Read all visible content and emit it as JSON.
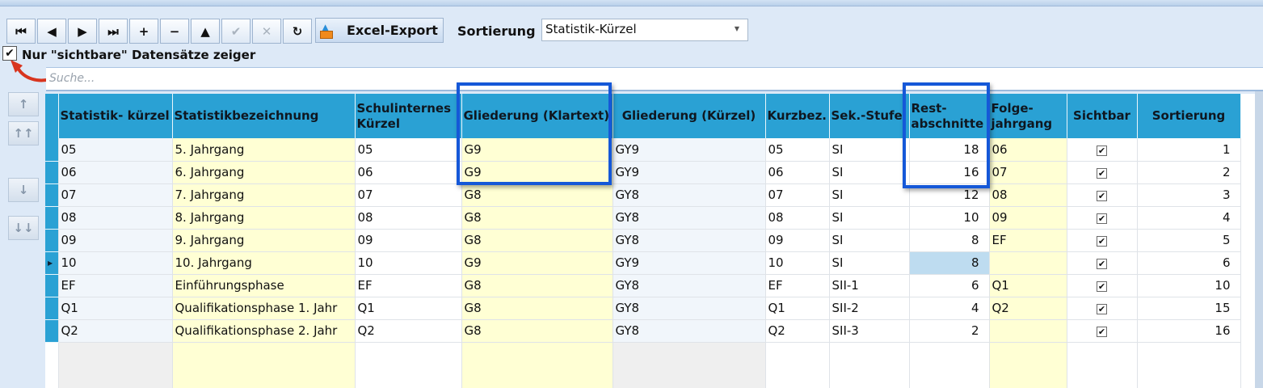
{
  "toolbar": {
    "nav_buttons": [
      {
        "name": "first-record-icon",
        "glyph": "⏮",
        "enabled": true
      },
      {
        "name": "prev-record-icon",
        "glyph": "◀",
        "enabled": true
      },
      {
        "name": "next-record-icon",
        "glyph": "▶",
        "enabled": true
      },
      {
        "name": "last-record-icon",
        "glyph": "⏭",
        "enabled": true
      },
      {
        "name": "add-record-icon",
        "glyph": "+",
        "enabled": true
      },
      {
        "name": "delete-record-icon",
        "glyph": "−",
        "enabled": true
      },
      {
        "name": "edit-record-icon",
        "glyph": "▲",
        "enabled": true
      },
      {
        "name": "confirm-icon",
        "glyph": "✔",
        "enabled": false
      },
      {
        "name": "cancel-icon",
        "glyph": "✕",
        "enabled": false
      },
      {
        "name": "refresh-icon",
        "glyph": "↻",
        "enabled": true
      }
    ],
    "excel_label": "Excel-Export",
    "sort_label": "Sortierung",
    "sort_value": "Statistik-Kürzel"
  },
  "filter": {
    "checked": true,
    "check_glyph": "✔",
    "label": "Nur \"sichtbare\" Datensätze zeiger"
  },
  "search": {
    "placeholder": "Suche..."
  },
  "move_buttons": [
    {
      "name": "move-up-icon",
      "glyph": "↑"
    },
    {
      "name": "move-top-icon",
      "glyph": "↑↑"
    },
    {
      "name": "move-down-icon",
      "glyph": "↓"
    },
    {
      "name": "move-bottom-icon",
      "glyph": "↓↓"
    }
  ],
  "grid": {
    "columns": [
      [
        "Statistik- kürzel"
      ],
      [
        "Statistikbezeichnung"
      ],
      [
        "Schulinternes",
        "Kürzel"
      ],
      [
        "Gliederung (Klartext)"
      ],
      [
        "Gliederung (Kürzel)"
      ],
      [
        "Kurzbez."
      ],
      [
        "Sek.-Stufe"
      ],
      [
        "Rest-",
        "abschnitte"
      ],
      [
        "Folge-",
        "jahrgang"
      ],
      [
        "Sichtbar"
      ],
      [
        "Sortierung"
      ]
    ],
    "rows": [
      {
        "kuerzel": "05",
        "bez": "5. Jahrgang",
        "intern": "05",
        "glk": "G9",
        "gk": "GY9",
        "kurz": "05",
        "stufe": "SI",
        "rest": "18",
        "folge": "06",
        "sichtbar": true,
        "sort": "1"
      },
      {
        "kuerzel": "06",
        "bez": "6. Jahrgang",
        "intern": "06",
        "glk": "G9",
        "gk": "GY9",
        "kurz": "06",
        "stufe": "SI",
        "rest": "16",
        "folge": "07",
        "sichtbar": true,
        "sort": "2"
      },
      {
        "kuerzel": "07",
        "bez": "7. Jahrgang",
        "intern": "07",
        "glk": "G8",
        "gk": "GY8",
        "kurz": "07",
        "stufe": "SI",
        "rest": "12",
        "folge": "08",
        "sichtbar": true,
        "sort": "3"
      },
      {
        "kuerzel": "08",
        "bez": "8. Jahrgang",
        "intern": "08",
        "glk": "G8",
        "gk": "GY8",
        "kurz": "08",
        "stufe": "SI",
        "rest": "10",
        "folge": "09",
        "sichtbar": true,
        "sort": "4"
      },
      {
        "kuerzel": "09",
        "bez": "9. Jahrgang",
        "intern": "09",
        "glk": "G8",
        "gk": "GY8",
        "kurz": "09",
        "stufe": "SI",
        "rest": "8",
        "folge": "EF",
        "sichtbar": true,
        "sort": "5"
      },
      {
        "kuerzel": "10",
        "bez": "10. Jahrgang",
        "intern": "10",
        "glk": "G9",
        "gk": "GY9",
        "kurz": "10",
        "stufe": "SI",
        "rest": "8",
        "folge": "",
        "sichtbar": true,
        "sort": "6",
        "current": true
      },
      {
        "kuerzel": "EF",
        "bez": "Einführungsphase",
        "intern": "EF",
        "glk": "G8",
        "gk": "GY8",
        "kurz": "EF",
        "stufe": "SII-1",
        "rest": "6",
        "folge": "Q1",
        "sichtbar": true,
        "sort": "10"
      },
      {
        "kuerzel": "Q1",
        "bez": "Qualifikationsphase 1. Jahr",
        "intern": "Q1",
        "glk": "G8",
        "gk": "GY8",
        "kurz": "Q1",
        "stufe": "SII-2",
        "rest": "4",
        "folge": "Q2",
        "sichtbar": true,
        "sort": "15"
      },
      {
        "kuerzel": "Q2",
        "bez": "Qualifikationsphase 2. Jahr",
        "intern": "Q2",
        "glk": "G8",
        "gk": "GY8",
        "kurz": "Q2",
        "stufe": "SII-3",
        "rest": "2",
        "folge": "",
        "sichtbar": true,
        "sort": "16"
      }
    ]
  },
  "colors": {
    "header": "#2aa1d4",
    "highlight": "#1558d8",
    "annotation_arrow": "#d8351f"
  }
}
